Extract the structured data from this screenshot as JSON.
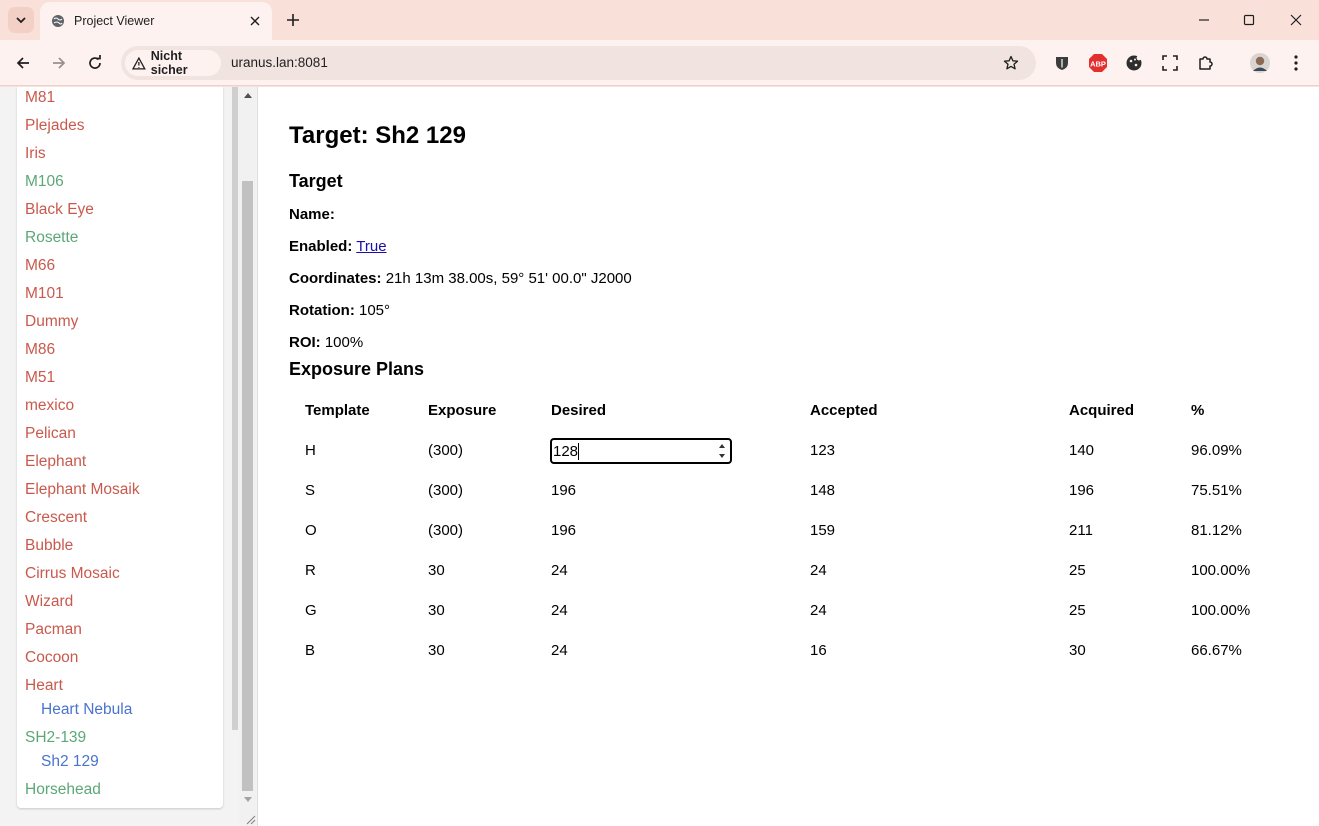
{
  "browser": {
    "tab_title": "Project Viewer",
    "security_label": "Nicht sicher",
    "url": "uranus.lan:8081",
    "extensions": [
      "bitwarden-icon",
      "adblock-icon",
      "cookie-icon",
      "screenshot-icon",
      "puzzle-icon"
    ],
    "abp_label": "ABP"
  },
  "sidebar": {
    "items": [
      {
        "label": "M81",
        "color": "red"
      },
      {
        "label": "Plejades",
        "color": "red"
      },
      {
        "label": "Iris",
        "color": "red"
      },
      {
        "label": "M106",
        "color": "green"
      },
      {
        "label": "Black Eye",
        "color": "red"
      },
      {
        "label": "Rosette",
        "color": "green"
      },
      {
        "label": "M66",
        "color": "red"
      },
      {
        "label": "M101",
        "color": "red"
      },
      {
        "label": "Dummy",
        "color": "red"
      },
      {
        "label": "M86",
        "color": "red"
      },
      {
        "label": "M51",
        "color": "red"
      },
      {
        "label": "mexico",
        "color": "red"
      },
      {
        "label": "Pelican",
        "color": "red"
      },
      {
        "label": "Elephant",
        "color": "red"
      },
      {
        "label": "Elephant Mosaik",
        "color": "red"
      },
      {
        "label": "Crescent",
        "color": "red"
      },
      {
        "label": "Bubble",
        "color": "red"
      },
      {
        "label": "Cirrus Mosaic",
        "color": "red"
      },
      {
        "label": "Wizard",
        "color": "red"
      },
      {
        "label": "Pacman",
        "color": "red"
      },
      {
        "label": "Cocoon",
        "color": "red"
      },
      {
        "label": "Heart",
        "color": "red"
      },
      {
        "label": "Heart Nebula",
        "color": "blue"
      },
      {
        "label": "SH2-139",
        "color": "green"
      },
      {
        "label": "Sh2 129",
        "color": "blue"
      },
      {
        "label": "Horsehead",
        "color": "green"
      }
    ],
    "colors": {
      "red": "#c9594d",
      "green": "#5ba876",
      "blue": "#4a73cf"
    }
  },
  "page": {
    "title": "Target: Sh2 129",
    "target_heading": "Target",
    "name_label": "Name:",
    "name_value": "",
    "enabled_label": "Enabled:",
    "enabled_value": "True",
    "coordinates_label": "Coordinates:",
    "coordinates_value": "21h 13m 38.00s, 59° 51' 00.0\" J2000",
    "rotation_label": "Rotation:",
    "rotation_value": "105°",
    "roi_label": "ROI:",
    "roi_value": "100%",
    "exposure_heading": "Exposure Plans"
  },
  "table": {
    "headers": [
      "Template",
      "Exposure",
      "Desired",
      "Accepted",
      "Acquired",
      "%"
    ],
    "rows": [
      [
        "H",
        "(300)",
        "128",
        "123",
        "140",
        "96.09%"
      ],
      [
        "S",
        "(300)",
        "196",
        "148",
        "196",
        "75.51%"
      ],
      [
        "O",
        "(300)",
        "196",
        "159",
        "211",
        "81.12%"
      ],
      [
        "R",
        "30",
        "24",
        "24",
        "25",
        "100.00%"
      ],
      [
        "G",
        "30",
        "24",
        "24",
        "25",
        "100.00%"
      ],
      [
        "B",
        "30",
        "24",
        "16",
        "30",
        "66.67%"
      ]
    ],
    "editing_row": 0
  }
}
